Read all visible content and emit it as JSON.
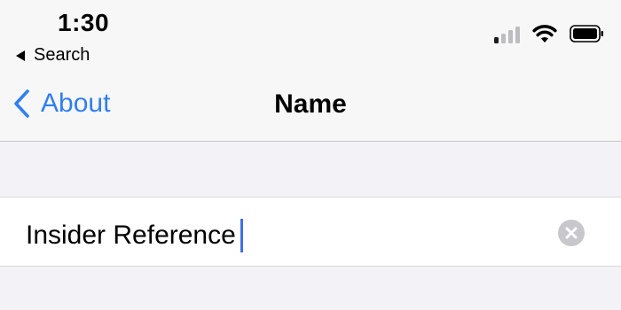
{
  "status_bar": {
    "time": "1:30",
    "back_app_label": "Search",
    "colors": {
      "signal_active": "#1c1c1e",
      "signal_inactive": "#bcbcc1"
    }
  },
  "nav": {
    "back_label": "About",
    "title": "Name",
    "accent_color": "#2f7ff3"
  },
  "field": {
    "value": "Insider Reference",
    "clear_icon": "clear-x-circle-icon"
  }
}
